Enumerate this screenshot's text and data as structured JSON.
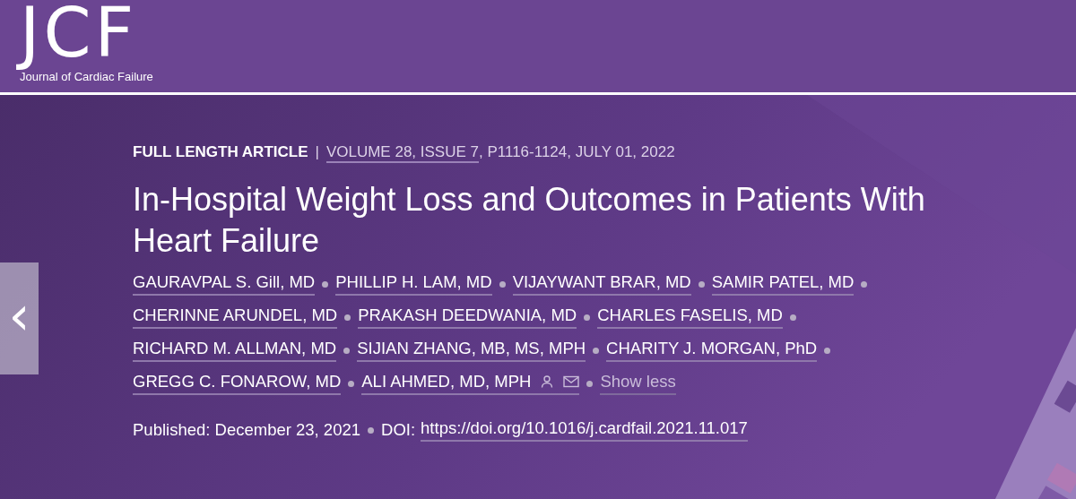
{
  "header": {
    "logo": "JCF",
    "journal_name": "Journal of Cardiac Failure"
  },
  "article": {
    "type": "FULL LENGTH ARTICLE",
    "separator": "|",
    "volume_link": "VOLUME 28, ISSUE 7",
    "citation_rest": ", P1116-1124, JULY 01, 2022",
    "title": "In-Hospital Weight Loss and Outcomes in Patients With Heart Failure",
    "authors": [
      {
        "name": "GAURAVPAL S. Gill, MD",
        "contact_icons": false
      },
      {
        "name": "PHILLIP H. LAM, MD",
        "contact_icons": false
      },
      {
        "name": "VIJAYWANT BRAR, MD",
        "contact_icons": false
      },
      {
        "name": "SAMIR PATEL, MD",
        "contact_icons": false
      },
      {
        "name": "CHERINNE ARUNDEL, MD",
        "contact_icons": false
      },
      {
        "name": "PRAKASH DEEDWANIA, MD",
        "contact_icons": false
      },
      {
        "name": "CHARLES FASELIS, MD",
        "contact_icons": false
      },
      {
        "name": "RICHARD M. ALLMAN, MD",
        "contact_icons": false
      },
      {
        "name": "SIJIAN ZHANG, MB, MS, MPH",
        "contact_icons": false
      },
      {
        "name": "CHARITY J. MORGAN, PhD",
        "contact_icons": false
      },
      {
        "name": "GREGG C. FONAROW, MD",
        "contact_icons": false
      },
      {
        "name": "ALI AHMED, MD, MPH",
        "contact_icons": true
      }
    ],
    "show_less": "Show less",
    "published": "Published: December 23, 2021",
    "doi_label": "DOI:",
    "doi_link": "https://doi.org/10.1016/j.cardfail.2021.11.017"
  },
  "carousel": {
    "prev_arrow": "‹"
  }
}
